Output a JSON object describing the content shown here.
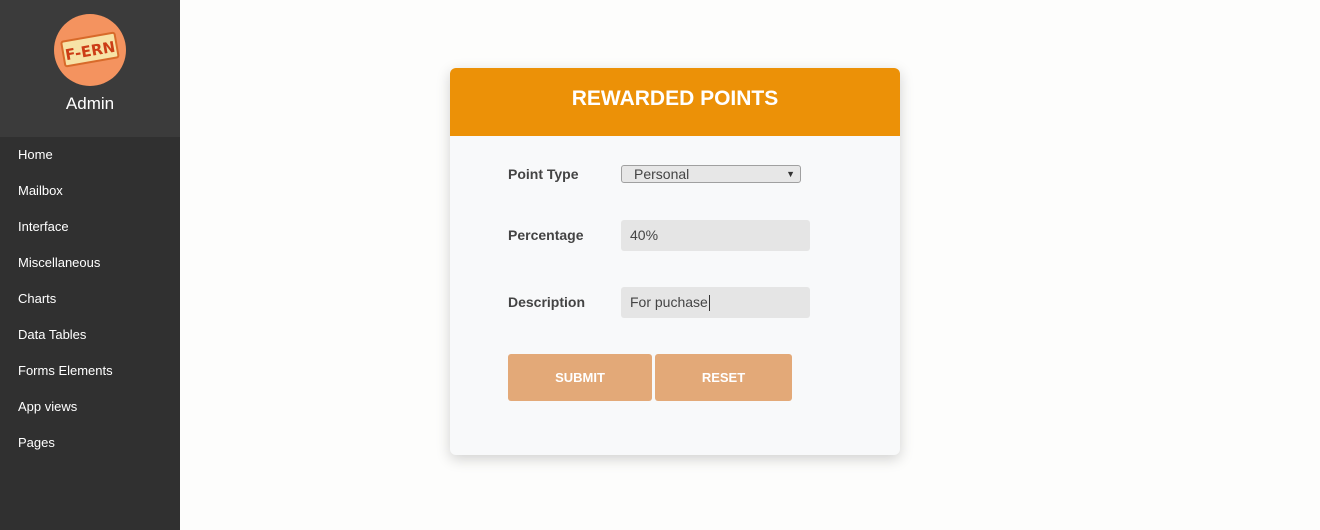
{
  "sidebar": {
    "logo_text": "F-ERN",
    "user_name": "Admin",
    "items": [
      {
        "label": "Home"
      },
      {
        "label": "Mailbox"
      },
      {
        "label": "Interface"
      },
      {
        "label": "Miscellaneous"
      },
      {
        "label": "Charts"
      },
      {
        "label": "Data Tables"
      },
      {
        "label": "Forms Elements"
      },
      {
        "label": "App views"
      },
      {
        "label": "Pages"
      }
    ]
  },
  "form": {
    "title": "REWARDED POINTS",
    "point_type": {
      "label": "Point Type",
      "value": "Personal"
    },
    "percentage": {
      "label": "Percentage",
      "value": "40%"
    },
    "description": {
      "label": "Description",
      "value": "For puchase"
    },
    "submit_label": "SUBMIT",
    "reset_label": "RESET"
  },
  "colors": {
    "sidebar_bg": "#303030",
    "header_accent": "#ec9107",
    "button_bg": "#e3a978",
    "avatar_bg": "#f4935f"
  },
  "icons": {
    "select_arrow": "caret-down-icon",
    "logo": "fern-logo"
  }
}
